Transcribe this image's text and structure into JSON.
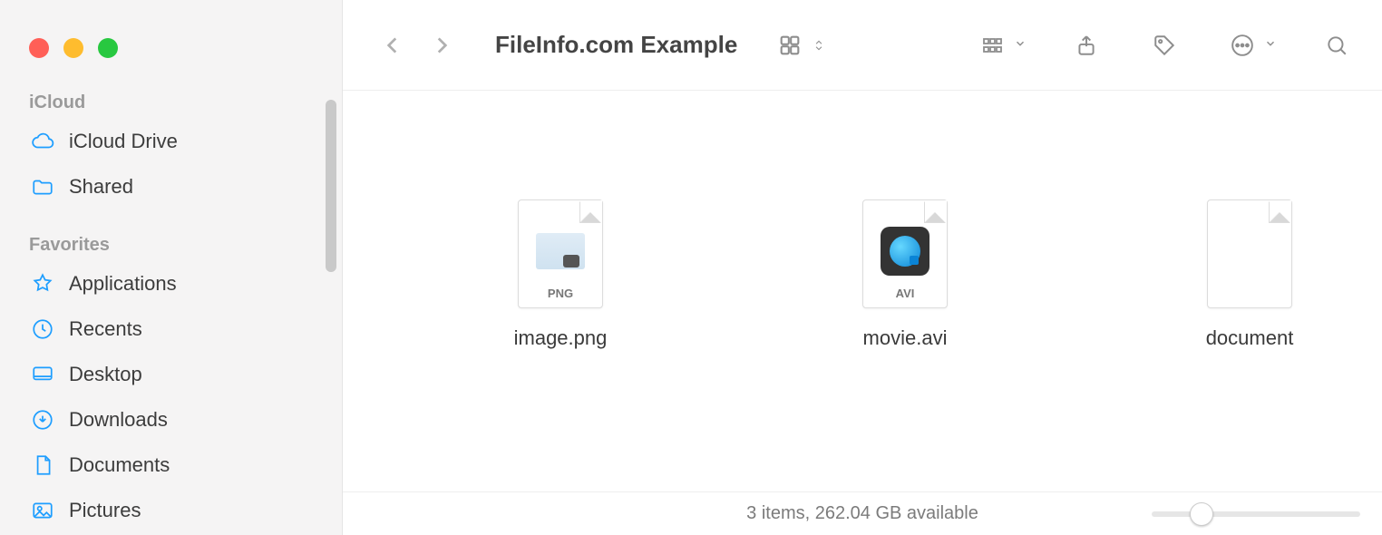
{
  "window": {
    "title": "FileInfo.com Example"
  },
  "sidebar": {
    "sections": [
      {
        "title": "iCloud",
        "items": [
          {
            "label": "iCloud Drive",
            "icon": "cloud-icon"
          },
          {
            "label": "Shared",
            "icon": "shared-folder-icon"
          }
        ]
      },
      {
        "title": "Favorites",
        "items": [
          {
            "label": "Applications",
            "icon": "applications-icon"
          },
          {
            "label": "Recents",
            "icon": "clock-icon"
          },
          {
            "label": "Desktop",
            "icon": "desktop-icon"
          },
          {
            "label": "Downloads",
            "icon": "downloads-icon"
          },
          {
            "label": "Documents",
            "icon": "document-icon"
          },
          {
            "label": "Pictures",
            "icon": "pictures-icon"
          }
        ]
      }
    ]
  },
  "files": [
    {
      "name": "image.png",
      "badge": "PNG",
      "kind": "png"
    },
    {
      "name": "movie.avi",
      "badge": "AVI",
      "kind": "avi"
    },
    {
      "name": "document",
      "badge": "",
      "kind": "blank"
    }
  ],
  "status": {
    "text": "3 items, 262.04 GB available"
  },
  "annotation": {
    "circled_file_index": 2,
    "color": "#f56b65"
  }
}
